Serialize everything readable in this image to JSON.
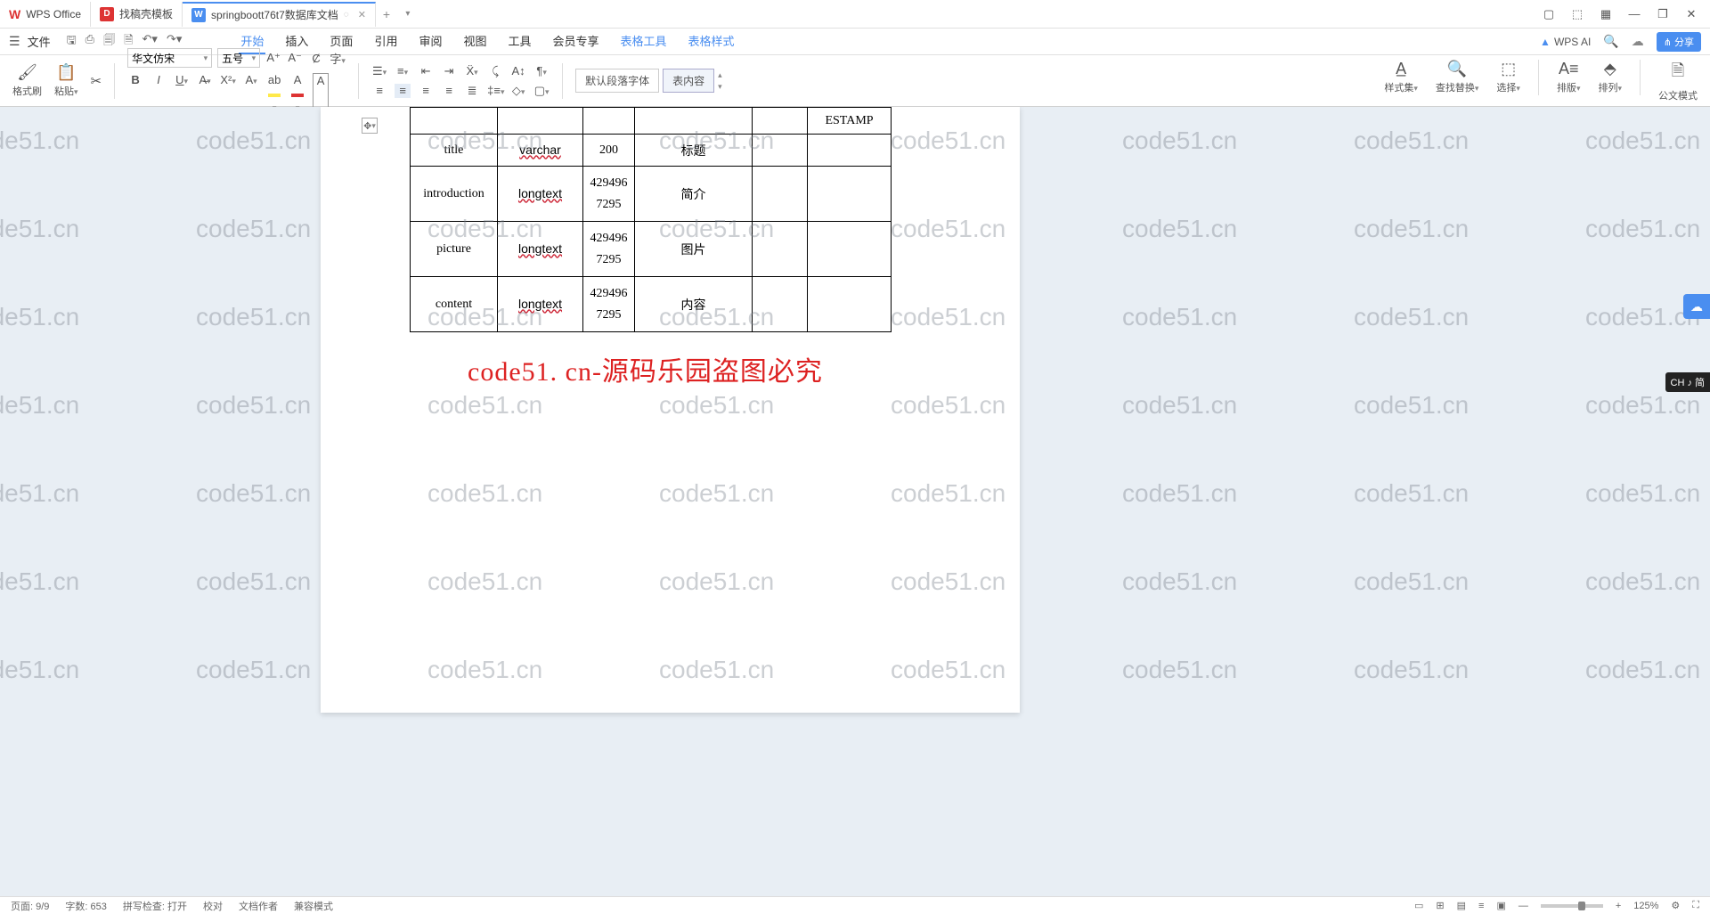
{
  "app": {
    "name": "WPS Office"
  },
  "tabs": [
    {
      "label": "WPS Office"
    },
    {
      "label": "找稿壳模板"
    },
    {
      "label": "springboott76t7数据库文档",
      "active": true
    }
  ],
  "menu": {
    "file": "文件",
    "items": [
      "开始",
      "插入",
      "页面",
      "引用",
      "审阅",
      "视图",
      "工具",
      "会员专享",
      "表格工具",
      "表格样式"
    ],
    "active": "开始",
    "wpsai": "WPS AI",
    "share": "分享"
  },
  "toolbar": {
    "format_painter": "格式刷",
    "paste": "粘贴",
    "font": "华文仿宋",
    "size": "五号",
    "style_default": "默认段落字体",
    "style_content": "表内容",
    "styleset": "样式集",
    "findreplace": "查找替换",
    "select": "选择",
    "layout": "排版",
    "arrange": "排列",
    "docmode": "公文模式"
  },
  "table": {
    "header_right": "ESTAMP",
    "rows": [
      {
        "c1": "title",
        "c2": "varchar",
        "c3": "200",
        "c4": "标题",
        "c5": "",
        "c6": ""
      },
      {
        "c1": "introduction",
        "c2": "longtext",
        "c3": "4294967295",
        "c4": "简介",
        "c5": "",
        "c6": ""
      },
      {
        "c1": "picture",
        "c2": "longtext",
        "c3": "4294967295",
        "c4": "图片",
        "c5": "",
        "c6": ""
      },
      {
        "c1": "content",
        "c2": "longtext",
        "c3": "4294967295",
        "c4": "内容",
        "c5": "",
        "c6": ""
      }
    ]
  },
  "banner": "code51. cn-源码乐园盗图必究",
  "watermark": "code51.cn",
  "ime": "CH ♪ 简",
  "status": {
    "page": "页面: 9/9",
    "words": "字数: 653",
    "spell": "拼写检查: 打开",
    "proof": "校对",
    "author": "文档作者",
    "mode": "兼容模式",
    "zoom": "125%"
  }
}
